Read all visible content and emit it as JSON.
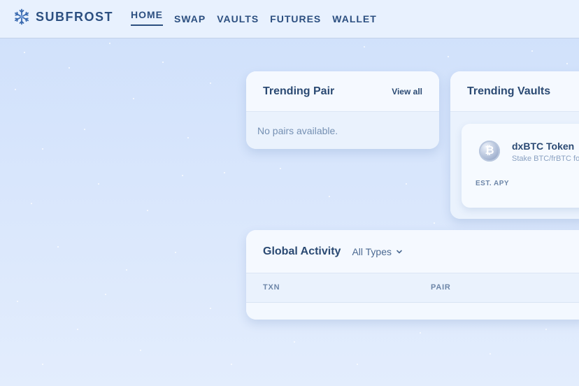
{
  "brand": {
    "name": "SUBFROST"
  },
  "nav": {
    "items": [
      {
        "label": "HOME",
        "active": true
      },
      {
        "label": "SWAP",
        "active": false
      },
      {
        "label": "VAULTS",
        "active": false
      },
      {
        "label": "FUTURES",
        "active": false
      },
      {
        "label": "WALLET",
        "active": false
      }
    ]
  },
  "trending_pair": {
    "title": "Trending Pair",
    "view_all": "View all",
    "empty": "No pairs available."
  },
  "trending_vaults": {
    "title": "Trending Vaults",
    "vault": {
      "name": "dxBTC Token",
      "description": "Stake BTC/frBTC fo",
      "apy_label": "EST. APY",
      "icon": "bitcoin-icon"
    }
  },
  "global_activity": {
    "title": "Global Activity",
    "filter": "All Types",
    "columns": [
      "TXN",
      "PAIR"
    ]
  },
  "colors": {
    "text_primary": "#2b4a73",
    "background": "#d6e5fb"
  }
}
